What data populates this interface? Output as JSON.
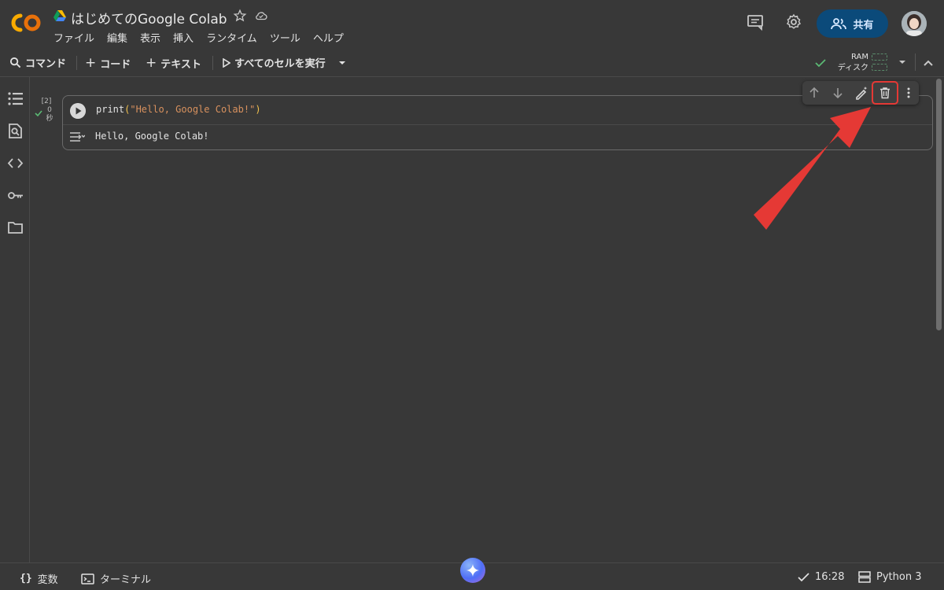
{
  "app": {
    "title": "はじめてのGoogle Colab",
    "logo_text": "CO"
  },
  "menu": [
    "ファイル",
    "編集",
    "表示",
    "挿入",
    "ランタイム",
    "ツール",
    "ヘルプ"
  ],
  "header": {
    "share_label": "共有"
  },
  "toolbar": {
    "command_label": "コマンド",
    "code_label": "コード",
    "text_label": "テキスト",
    "run_all_label": "すべてのセルを実行",
    "ram_label": "RAM",
    "disk_label": "ディスク"
  },
  "cell": {
    "exec_count": "[2]",
    "exec_time_value": "0",
    "exec_time_unit": "秒",
    "code_fn": "print",
    "code_paren_open": "(",
    "code_string": "\"Hello, Google Colab!\"",
    "code_paren_close": ")",
    "output": "Hello, Google Colab!"
  },
  "statusbar": {
    "variables_label": "変数",
    "terminal_label": "ターミナル",
    "time": "16:28",
    "runtime": "Python 3"
  },
  "colors": {
    "background": "#383838",
    "accent_share": "#0b4a7a",
    "annotation_arrow": "#e53935",
    "status_ok": "#5bb974",
    "code_string": "#d8915e",
    "code_paren": "#f2c14e"
  }
}
